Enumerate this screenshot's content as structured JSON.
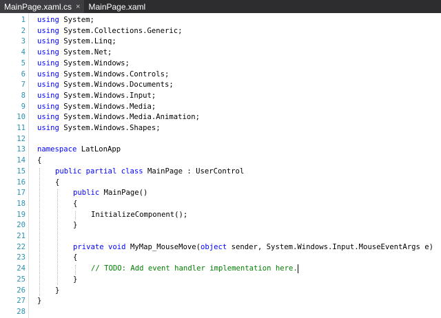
{
  "tabs": [
    {
      "label": "MainPage.xaml.cs",
      "close": "×",
      "active": true
    },
    {
      "label": "MainPage.xaml",
      "active": false
    }
  ],
  "lines": [
    {
      "n": "1",
      "indent": 0,
      "parts": [
        {
          "t": "using",
          "c": "kw"
        },
        {
          "t": " System;"
        }
      ]
    },
    {
      "n": "2",
      "indent": 0,
      "parts": [
        {
          "t": "using",
          "c": "kw"
        },
        {
          "t": " System.Collections.Generic;"
        }
      ]
    },
    {
      "n": "3",
      "indent": 0,
      "parts": [
        {
          "t": "using",
          "c": "kw"
        },
        {
          "t": " System.Linq;"
        }
      ]
    },
    {
      "n": "4",
      "indent": 0,
      "parts": [
        {
          "t": "using",
          "c": "kw"
        },
        {
          "t": " System.Net;"
        }
      ]
    },
    {
      "n": "5",
      "indent": 0,
      "parts": [
        {
          "t": "using",
          "c": "kw"
        },
        {
          "t": " System.Windows;"
        }
      ]
    },
    {
      "n": "6",
      "indent": 0,
      "parts": [
        {
          "t": "using",
          "c": "kw"
        },
        {
          "t": " System.Windows.Controls;"
        }
      ]
    },
    {
      "n": "7",
      "indent": 0,
      "parts": [
        {
          "t": "using",
          "c": "kw"
        },
        {
          "t": " System.Windows.Documents;"
        }
      ]
    },
    {
      "n": "8",
      "indent": 0,
      "parts": [
        {
          "t": "using",
          "c": "kw"
        },
        {
          "t": " System.Windows.Input;"
        }
      ]
    },
    {
      "n": "9",
      "indent": 0,
      "parts": [
        {
          "t": "using",
          "c": "kw"
        },
        {
          "t": " System.Windows.Media;"
        }
      ]
    },
    {
      "n": "10",
      "indent": 0,
      "parts": [
        {
          "t": "using",
          "c": "kw"
        },
        {
          "t": " System.Windows.Media.Animation;"
        }
      ]
    },
    {
      "n": "11",
      "indent": 0,
      "parts": [
        {
          "t": "using",
          "c": "kw"
        },
        {
          "t": " System.Windows.Shapes;"
        }
      ]
    },
    {
      "n": "12",
      "indent": 0,
      "parts": []
    },
    {
      "n": "13",
      "indent": 0,
      "parts": [
        {
          "t": "namespace",
          "c": "kw"
        },
        {
          "t": " LatLonApp"
        }
      ]
    },
    {
      "n": "14",
      "indent": 0,
      "parts": [
        {
          "t": "{"
        }
      ]
    },
    {
      "n": "15",
      "indent": 1,
      "parts": [
        {
          "t": "public",
          "c": "kw"
        },
        {
          "t": " "
        },
        {
          "t": "partial",
          "c": "kw"
        },
        {
          "t": " "
        },
        {
          "t": "class",
          "c": "kw"
        },
        {
          "t": " MainPage : UserControl"
        }
      ]
    },
    {
      "n": "16",
      "indent": 1,
      "parts": [
        {
          "t": "{"
        }
      ]
    },
    {
      "n": "17",
      "indent": 2,
      "parts": [
        {
          "t": "public",
          "c": "kw"
        },
        {
          "t": " MainPage()"
        }
      ]
    },
    {
      "n": "18",
      "indent": 2,
      "parts": [
        {
          "t": "{"
        }
      ]
    },
    {
      "n": "19",
      "indent": 3,
      "parts": [
        {
          "t": "InitializeComponent();"
        }
      ]
    },
    {
      "n": "20",
      "indent": 2,
      "parts": [
        {
          "t": "}"
        }
      ]
    },
    {
      "n": "21",
      "indent": 0,
      "parts": []
    },
    {
      "n": "22",
      "indent": 2,
      "parts": [
        {
          "t": "private",
          "c": "kw"
        },
        {
          "t": " "
        },
        {
          "t": "void",
          "c": "kw"
        },
        {
          "t": " MyMap_MouseMove("
        },
        {
          "t": "object",
          "c": "kw"
        },
        {
          "t": " sender, System.Windows.Input.MouseEventArgs e)"
        }
      ]
    },
    {
      "n": "23",
      "indent": 2,
      "parts": [
        {
          "t": "{"
        }
      ]
    },
    {
      "n": "24",
      "indent": 3,
      "parts": [
        {
          "t": "// TODO: Add event handler implementation here.",
          "c": "cm"
        }
      ],
      "caret": true
    },
    {
      "n": "25",
      "indent": 2,
      "parts": [
        {
          "t": "}"
        }
      ]
    },
    {
      "n": "26",
      "indent": 1,
      "parts": [
        {
          "t": "}"
        }
      ]
    },
    {
      "n": "27",
      "indent": 0,
      "parts": [
        {
          "t": "}"
        }
      ]
    },
    {
      "n": "28",
      "indent": 0,
      "parts": []
    }
  ]
}
